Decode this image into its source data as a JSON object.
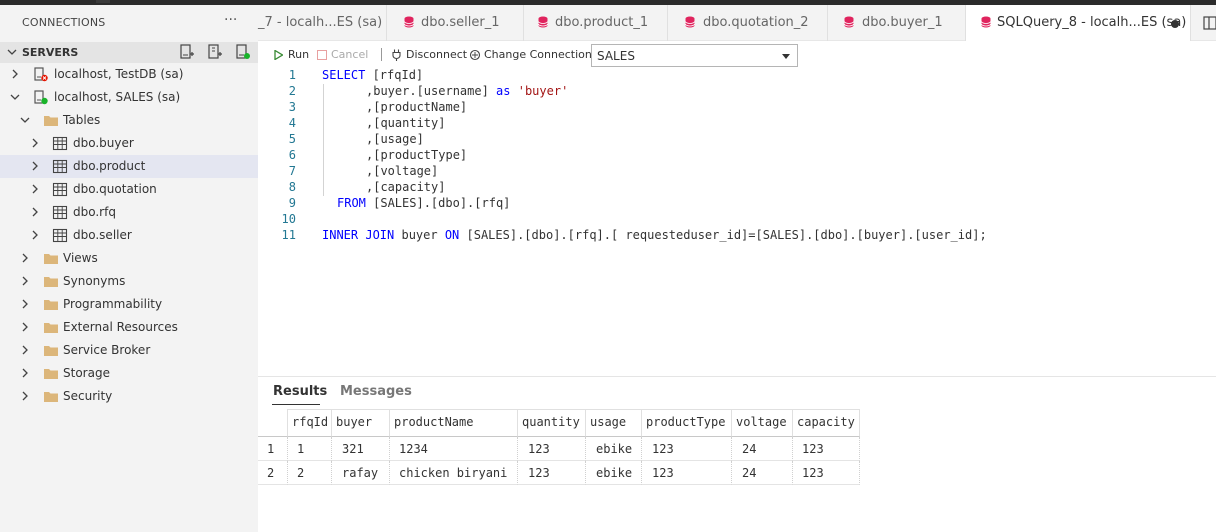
{
  "sidebar": {
    "title": "CONNECTIONS",
    "more": "···",
    "servers_label": "SERVERS",
    "tree": [
      {
        "label": "localhost, TestDB (sa)"
      },
      {
        "label": "localhost, SALES (sa)"
      },
      {
        "label": "Tables"
      },
      {
        "label": "dbo.buyer"
      },
      {
        "label": "dbo.product"
      },
      {
        "label": "dbo.quotation"
      },
      {
        "label": "dbo.rfq"
      },
      {
        "label": "dbo.seller"
      },
      {
        "label": "Views"
      },
      {
        "label": "Synonyms"
      },
      {
        "label": "Programmability"
      },
      {
        "label": "External Resources"
      },
      {
        "label": "Service Broker"
      },
      {
        "label": "Storage"
      },
      {
        "label": "Security"
      }
    ]
  },
  "tabs": [
    {
      "label": "_7 - localh...ES (sa)"
    },
    {
      "label": "dbo.seller_1"
    },
    {
      "label": "dbo.product_1"
    },
    {
      "label": "dbo.quotation_2"
    },
    {
      "label": "dbo.buyer_1"
    },
    {
      "label": "SQLQuery_8 - localh...ES (sa)"
    }
  ],
  "toolbar": {
    "run": "Run",
    "cancel": "Cancel",
    "disconnect": "Disconnect",
    "change_connection": "Change Connection",
    "database": "SALES"
  },
  "editor": {
    "line_numbers": [
      "1",
      "2",
      "3",
      "4",
      "5",
      "6",
      "7",
      "8",
      "9",
      "10",
      "11"
    ],
    "kw": {
      "select": "SELECT",
      "as": "as",
      "from": "FROM",
      "inner_join": "INNER JOIN",
      "on": "ON"
    },
    "code": {
      "l1": " [rfqId]",
      "l2a": ",buyer.[username] ",
      "l2b": " ",
      "l2str": "'buyer'",
      "l3": ",[productName]",
      "l4": ",[quantity]",
      "l5": ",[usage]",
      "l6": ",[productType]",
      "l7": ",[voltage]",
      "l8": ",[capacity]",
      "l9": " [SALES].[dbo].[rfq]",
      "l11a": " buyer ",
      "l11b": " [SALES].[dbo].[rfq].[ requesteduser_id]=[SALES].[dbo].[buyer].[user_id];"
    }
  },
  "results": {
    "tab_results": "Results",
    "tab_messages": "Messages",
    "columns": [
      "rfqId",
      "buyer",
      "productName",
      "quantity",
      "usage",
      "productType",
      "voltage",
      "capacity"
    ],
    "rows": [
      {
        "num": "1",
        "cells": [
          "1",
          "321",
          "1234",
          "123",
          "ebike",
          "123",
          "24",
          "123"
        ]
      },
      {
        "num": "2",
        "cells": [
          "2",
          "rafay",
          "chicken biryani",
          "123",
          "ebike",
          "123",
          "24",
          "123"
        ]
      }
    ]
  },
  "colors": {
    "keyword": "#0000ff",
    "string": "#a31515",
    "line_number": "#237893",
    "selection": "#e4e6f1",
    "tab_icon": "#e0245e",
    "folder": "#dcb67a",
    "connected": "#19b32a",
    "disconnected": "#e51400",
    "run": "#388a34"
  }
}
